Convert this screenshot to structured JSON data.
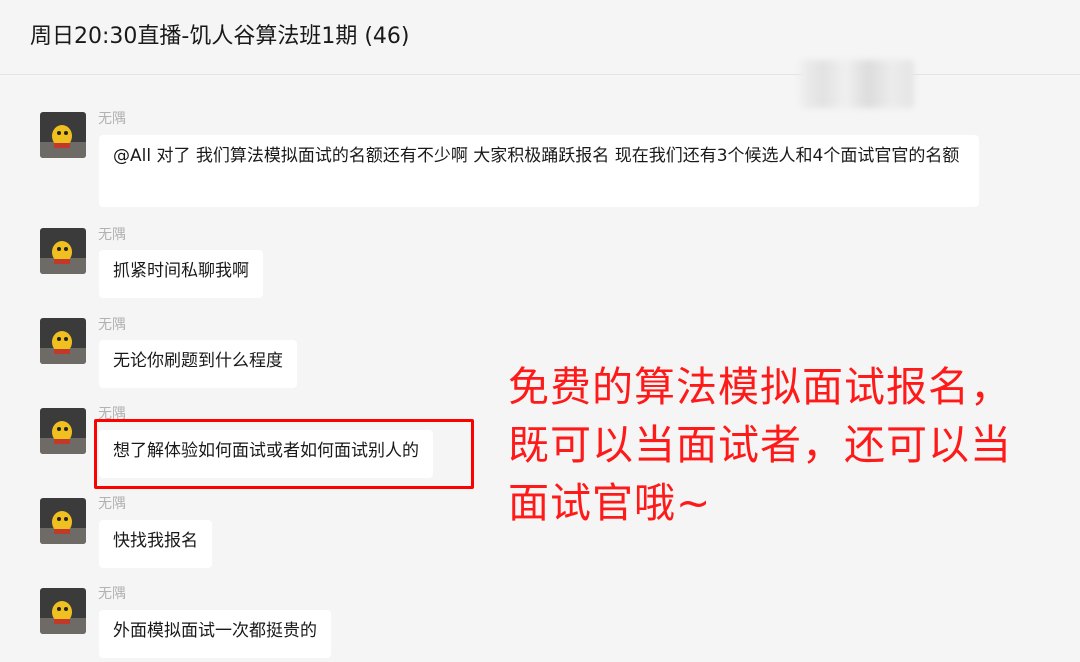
{
  "header": {
    "title": "周日20:30直播-饥人谷算法班1期 (46)"
  },
  "messages": [
    {
      "sender": "无隅",
      "text": "@All 对了 我们算法模拟面试的名额还有不少啊 大家积极踊跃报名 现在我们还有3个候选人和4个面试官官的名额"
    },
    {
      "sender": "无隅",
      "text": "抓紧时间私聊我啊"
    },
    {
      "sender": "无隅",
      "text": "无论你刷题到什么程度"
    },
    {
      "sender": "无隅",
      "text": "想了解体验如何面试或者如何面试别人的"
    },
    {
      "sender": "无隅",
      "text": "快找我报名"
    },
    {
      "sender": "无隅",
      "text": "外面模拟面试一次都挺贵的"
    }
  ],
  "overlay_note": {
    "lines": [
      "免费的算法模拟面试报名，",
      "既可以当面试者，还可以当",
      "面试官哦~"
    ],
    "color": "#ff1a1a"
  },
  "highlight_color": "#ff0000"
}
